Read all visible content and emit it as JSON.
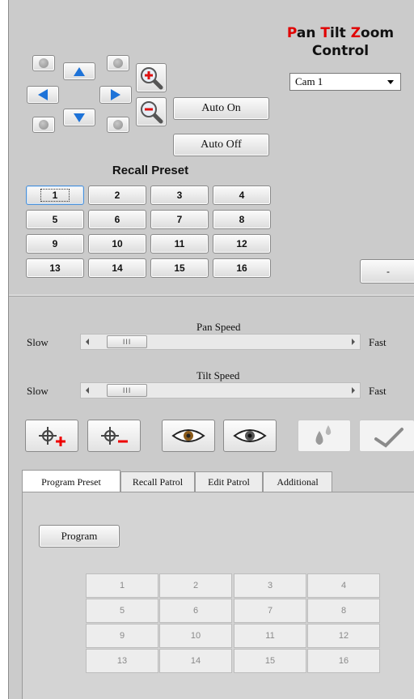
{
  "title": {
    "part1_letter": "P",
    "part1_rest": "an ",
    "part2_letter": "T",
    "part2_rest": "ilt ",
    "part3_letter": "Z",
    "part3_rest": "oom",
    "line2": "Control"
  },
  "camera": {
    "selected": "Cam 1"
  },
  "auto": {
    "on": "Auto On",
    "off": "Auto Off"
  },
  "recall_preset": {
    "heading": "Recall Preset",
    "buttons": [
      "1",
      "2",
      "3",
      "4",
      "5",
      "6",
      "7",
      "8",
      "9",
      "10",
      "11",
      "12",
      "13",
      "14",
      "15",
      "16"
    ]
  },
  "minus_button": "-",
  "pan": {
    "label": "Pan Speed",
    "slow": "Slow",
    "fast": "Fast",
    "thumb": "III",
    "level": 0.04
  },
  "tilt": {
    "label": "Tilt Speed",
    "slow": "Slow",
    "fast": "Fast",
    "thumb": "III",
    "level": 0.04
  },
  "tabs": [
    {
      "label": "Program Preset"
    },
    {
      "label": "Recall Patrol"
    },
    {
      "label": "Edit Patrol"
    },
    {
      "label": "Additional"
    }
  ],
  "program": {
    "button": "Program",
    "grid": [
      "1",
      "2",
      "3",
      "4",
      "5",
      "6",
      "7",
      "8",
      "9",
      "10",
      "11",
      "12",
      "13",
      "14",
      "15",
      "16"
    ]
  },
  "colors": {
    "arrow_blue": "#1e73d8",
    "title_red": "#e00000",
    "background": "#cbcbcb"
  }
}
